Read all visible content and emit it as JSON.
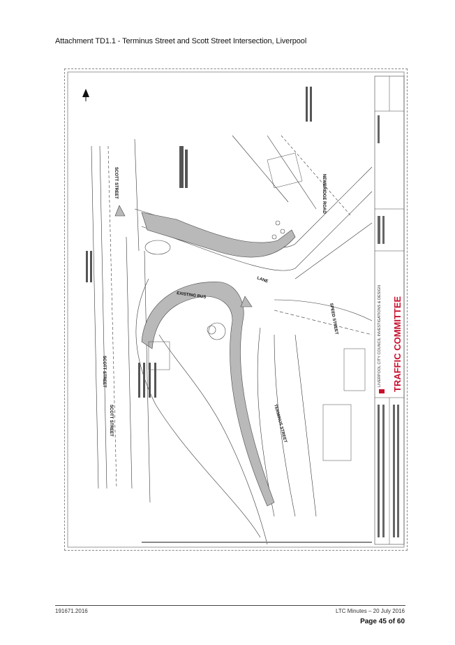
{
  "document": {
    "title": "Attachment TD1.1 - Terminus Street and Scott Street Intersection, Liverpool"
  },
  "drawing": {
    "street_labels": {
      "scott_street_1": "SCOTT STREET",
      "scott_street_2": "SCOTT STREET",
      "scott_street_3": "SCOTT STREET",
      "newbridge_road": "NEWBRIDGE ROAD",
      "terminus_street": "TERMINUS STREET",
      "speed_street": "SPEED STREET",
      "lane": "LANE",
      "existing_bus": "EXISTING BUS"
    },
    "title_block": {
      "organisation": "LIVERPOOL CITY COUNCIL INVESTIGATIONS & DESIGN",
      "committee": "TRAFFIC COMMITTEE"
    },
    "colors": {
      "proposed_works": "#b9b9b9",
      "linework": "#333333",
      "committee_red": "#c8102e",
      "frame": "#888888"
    }
  },
  "footer": {
    "left": "191671.2016",
    "right": "LTC Minutes – 20 July 2016",
    "page": "Page 45 of 60"
  }
}
